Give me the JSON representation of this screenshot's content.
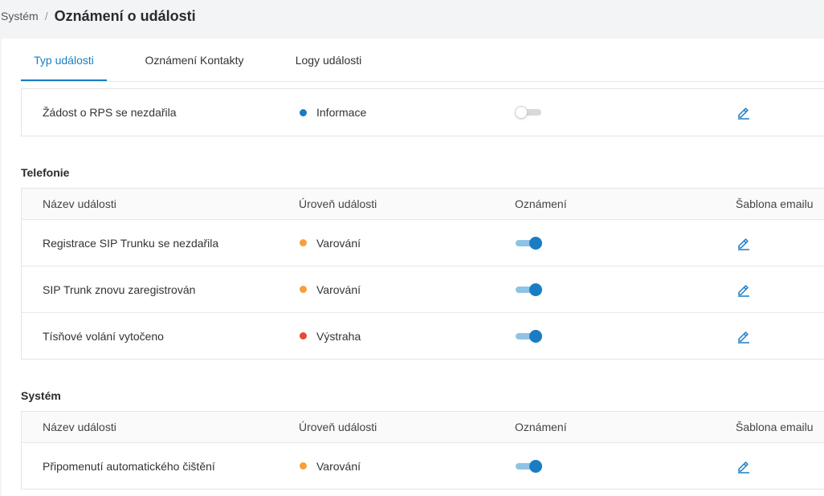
{
  "breadcrumb": {
    "parent": "Systém",
    "separator": "/",
    "current": "Oznámení o události"
  },
  "tabs": [
    {
      "label": "Typ události",
      "active": true
    },
    {
      "label": "Oznámení Kontakty",
      "active": false
    },
    {
      "label": "Logy události",
      "active": false
    }
  ],
  "colors": {
    "accent": "#1a7dc4",
    "level_info": "#1a7dc4",
    "level_warning": "#f5a03a",
    "level_alert": "#e8492f"
  },
  "tables": [
    {
      "title": "",
      "rows": [
        {
          "name": "Žádost o RPS se nezdařila",
          "level": "Informace",
          "level_color": "#1a7dc4",
          "notification_enabled": false,
          "edit_icon": "pencil-icon"
        }
      ]
    },
    {
      "title": "Telefonie",
      "columns": {
        "name": "Název události",
        "level": "Úroveň události",
        "notification": "Oznámení",
        "template": "Šablona emailu"
      },
      "rows": [
        {
          "name": "Registrace SIP Trunku se nezdařila",
          "level": "Varování",
          "level_color": "#f5a03a",
          "notification_enabled": true,
          "edit_icon": "pencil-icon"
        },
        {
          "name": "SIP Trunk znovu zaregistrován",
          "level": "Varování",
          "level_color": "#f5a03a",
          "notification_enabled": true,
          "edit_icon": "pencil-icon"
        },
        {
          "name": "Tísňové volání vytočeno",
          "level": "Výstraha",
          "level_color": "#e8492f",
          "notification_enabled": true,
          "edit_icon": "pencil-icon"
        }
      ]
    },
    {
      "title": "Systém",
      "columns": {
        "name": "Název události",
        "level": "Úroveň události",
        "notification": "Oznámení",
        "template": "Šablona emailu"
      },
      "rows": [
        {
          "name": "Připomenutí automatického čištění",
          "level": "Varování",
          "level_color": "#f5a03a",
          "notification_enabled": true,
          "edit_icon": "pencil-icon"
        }
      ]
    }
  ]
}
